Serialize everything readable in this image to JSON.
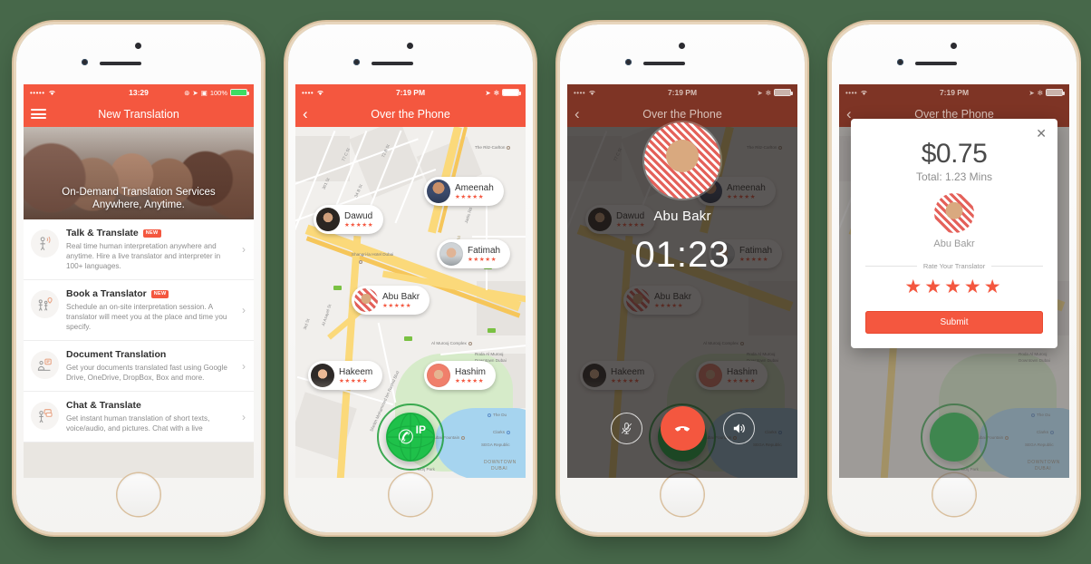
{
  "background_color": "#47684a",
  "accent_color": "#f4573f",
  "phones": [
    {
      "id": "home",
      "status_bar": {
        "signal": "•••••",
        "wifi": "wifi-icon",
        "time": "13:29",
        "battery_text": "100%"
      },
      "nav": {
        "title": "New Translation",
        "left_icon": "hamburger-icon"
      },
      "hero": {
        "line1": "On-Demand Translation Services",
        "line2": "Anywhere, Anytime."
      },
      "list": [
        {
          "title": "Talk & Translate",
          "badge": "NEW",
          "desc": "Real time human interpretation anywhere and anytime. Hire a live translator and interpreter in 100+ languages.",
          "icon": "person-speaking-icon"
        },
        {
          "title": "Book a Translator",
          "badge": "NEW",
          "desc": "Schedule an on-site interpretation session. A translator will meet you at the place and time you specify.",
          "icon": "people-pin-icon"
        },
        {
          "title": "Document Translation",
          "badge": "",
          "desc": "Get your documents translated fast using Google Drive, OneDrive, DropBox, Box and more.",
          "icon": "document-icon"
        },
        {
          "title": "Chat & Translate",
          "badge": "",
          "desc": "Get instant human translation of short texts, voice/audio, and pictures. Chat with a live",
          "icon": "chat-bubble-icon"
        }
      ]
    },
    {
      "id": "map",
      "status_bar": {
        "signal": "••••",
        "wifi": "wifi-icon",
        "time": "7:19 PM",
        "battery_text": ""
      },
      "nav": {
        "title": "Over the Phone",
        "left_icon": "back-chevron-icon"
      },
      "call_button": {
        "label": "IP",
        "icon": "phone-icon",
        "color": "#1fc14a"
      }
    },
    {
      "id": "in-call",
      "status_bar": {
        "signal": "••••",
        "wifi": "wifi-icon",
        "time": "7:19 PM",
        "battery_text": ""
      },
      "nav": {
        "title": "Over the Phone",
        "left_icon": "back-chevron-icon"
      },
      "call": {
        "name": "Abu Bakr",
        "timer": "01:23",
        "controls": [
          {
            "name": "mute-button",
            "icon": "microphone-muted-icon"
          },
          {
            "name": "end-call-button",
            "icon": "phone-hangup-icon"
          },
          {
            "name": "speaker-button",
            "icon": "speaker-icon"
          }
        ]
      }
    },
    {
      "id": "receipt",
      "status_bar": {
        "signal": "••••",
        "wifi": "wifi-icon",
        "time": "7:19 PM",
        "battery_text": ""
      },
      "nav": {
        "title": "Over the Phone",
        "left_icon": "back-chevron-icon"
      },
      "modal": {
        "close_icon": "close-icon",
        "price": "$0.75",
        "total": "Total: 1.23 Mins",
        "translator_name": "Abu Bakr",
        "rate_label": "Rate Your Translator",
        "stars": 5,
        "stars_glyph": "★★★★★",
        "submit_label": "Submit"
      }
    }
  ],
  "translators": [
    {
      "name": "Ameenah",
      "stars": "★★★★★"
    },
    {
      "name": "Dawud",
      "stars": "★★★★★"
    },
    {
      "name": "Fatimah",
      "stars": "★★★★★"
    },
    {
      "name": "Abu Bakr",
      "stars": "★★★★★"
    },
    {
      "name": "Hakeem",
      "stars": "★★★★★"
    },
    {
      "name": "Hashim",
      "stars": "★★★★★"
    }
  ],
  "map_labels": {
    "streets": [
      "77 C St",
      "72 B St",
      "301 St",
      "34 B St",
      "Jadis Rd",
      "Sheikh Zayed Rd",
      "Al Asayel St",
      "Sheikh Mohammed bin Rashid Blvd",
      "3rd St"
    ],
    "pois": [
      "The Ritz-Carlton",
      "Shangri-la Hotel Dubai",
      "Al Murooj Complex",
      "Roda Al Murooj Downtown Dubai",
      "Dubai Fountain",
      "The Du",
      "Clarks",
      "SEGA Republic",
      "DOWNTOWN DUBAI",
      "Burj Park"
    ]
  }
}
